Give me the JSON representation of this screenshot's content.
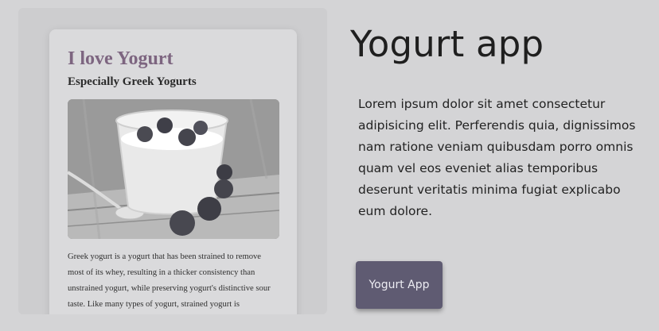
{
  "preview": {
    "card_title": "I love Yogurt",
    "card_subtitle": "Especially Greek Yogurts",
    "image_subject": "yogurt-with-blueberries-photo",
    "card_text": "Greek yogurt is a yogurt that has been strained to remove most of its whey, resulting in a thicker consistency than unstrained yogurt, while preserving yogurt's distinctive sour taste. Like many types of yogurt, strained yogurt is"
  },
  "main": {
    "heading": "Yogurt app",
    "description": "Lorem ipsum dolor sit amet consectetur adipisicing elit. Perferendis quia, dignissimos nam ratione veniam quibusdam porro omnis quam vel eos eveniet alias temporibus deserunt veritatis minima fugiat explicabo eum dolore.",
    "button_label": "Yogurt App"
  },
  "colors": {
    "background": "#d4d4d6",
    "card_title": "#7d6580",
    "button": "#5f5b72"
  }
}
